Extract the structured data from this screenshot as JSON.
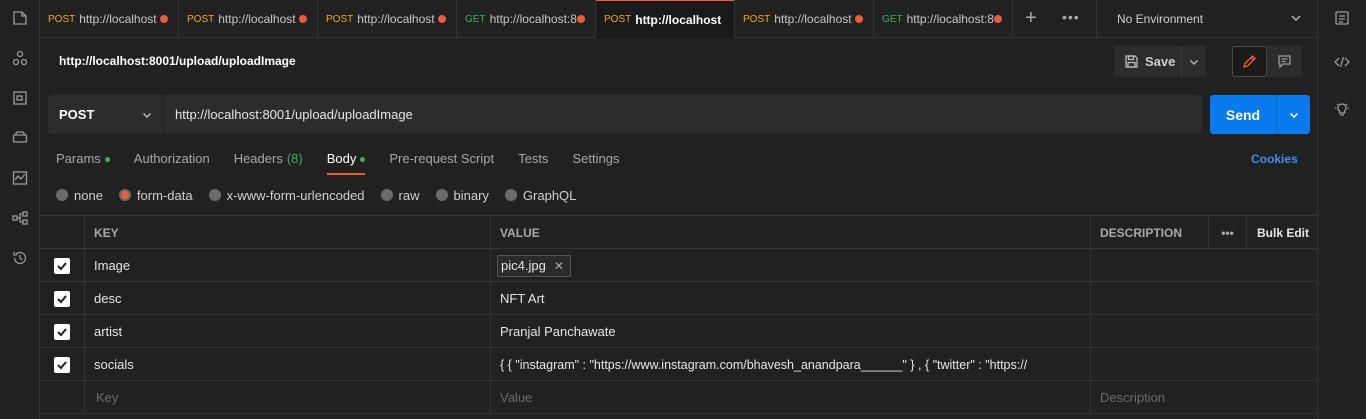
{
  "tabs": [
    {
      "method": "POST",
      "url": "http://localhost",
      "active": false
    },
    {
      "method": "POST",
      "url": "http://localhost",
      "active": false
    },
    {
      "method": "POST",
      "url": "http://localhost",
      "active": false
    },
    {
      "method": "GET",
      "url": "http://localhost:8",
      "active": false
    },
    {
      "method": "POST",
      "url": "http://localhost",
      "active": true
    },
    {
      "method": "POST",
      "url": "http://localhost",
      "active": false
    },
    {
      "method": "GET",
      "url": "http://localhost:8",
      "active": false
    }
  ],
  "environment": {
    "label": "No Environment"
  },
  "request": {
    "title": "http://localhost:8001/upload/uploadImage",
    "method": "POST",
    "url": "http://localhost:8001/upload/uploadImage",
    "save_label": "Save",
    "send_label": "Send"
  },
  "req_tabs": {
    "params": "Params",
    "authorization": "Authorization",
    "headers": "Headers",
    "headers_count": "(8)",
    "body": "Body",
    "prerequest": "Pre-request Script",
    "tests": "Tests",
    "settings": "Settings",
    "cookies": "Cookies"
  },
  "body_types": {
    "none": "none",
    "form_data": "form-data",
    "urlencoded": "x-www-form-urlencoded",
    "raw": "raw",
    "binary": "binary",
    "graphql": "GraphQL",
    "selected": "form-data"
  },
  "table": {
    "headers": {
      "key": "KEY",
      "value": "VALUE",
      "description": "DESCRIPTION",
      "bulk_edit": "Bulk Edit"
    },
    "rows": [
      {
        "key": "Image",
        "value": "pic4.jpg",
        "type": "file"
      },
      {
        "key": "desc",
        "value": "NFT Art",
        "type": "text"
      },
      {
        "key": "artist",
        "value": "Pranjal Panchawate",
        "type": "text"
      },
      {
        "key": "socials",
        "value": "{ { \"instagram\" : \"https://www.instagram.com/bhavesh_anandpara______\" }  , { \"twitter\" : \"https://",
        "type": "text"
      }
    ],
    "placeholders": {
      "key": "Key",
      "value": "Value",
      "description": "Description"
    }
  },
  "colors": {
    "accent": "#ea5c3a",
    "send": "#097bed",
    "post": "#f5a623",
    "get": "#3fae5c",
    "link": "#3e8fe8"
  }
}
